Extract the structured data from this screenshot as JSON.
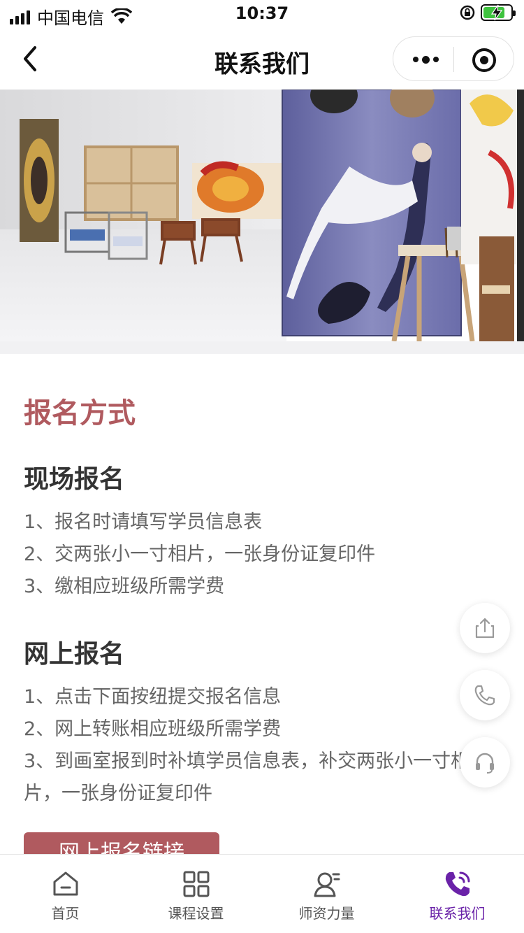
{
  "status_bar": {
    "carrier": "中国电信",
    "time": "10:37"
  },
  "nav": {
    "title": "联系我们"
  },
  "content": {
    "section_title": "报名方式",
    "onsite": {
      "title": "现场报名",
      "items": [
        "1、报名时请填写学员信息表",
        "2、交两张小一寸相片，一张身份证复印件",
        "3、缴相应班级所需学费"
      ]
    },
    "online": {
      "title": "网上报名",
      "items": [
        "1、点击下面按纽提交报名信息",
        "2、网上转账相应班级所需学费",
        "3、到画室报到时补填学员信息表，补交两张小一寸相",
        "片，一张身份证复印件"
      ]
    },
    "cta_label": "网上报名链接"
  },
  "tabs": [
    {
      "label": "首页",
      "icon": "home-icon"
    },
    {
      "label": "课程设置",
      "icon": "grid-icon"
    },
    {
      "label": "师资力量",
      "icon": "teacher-icon"
    },
    {
      "label": "联系我们",
      "icon": "phone-icon",
      "active": true
    }
  ],
  "colors": {
    "accent": "#b05a5f",
    "tab_active": "#6a22a8",
    "battery": "#3ec33e"
  }
}
